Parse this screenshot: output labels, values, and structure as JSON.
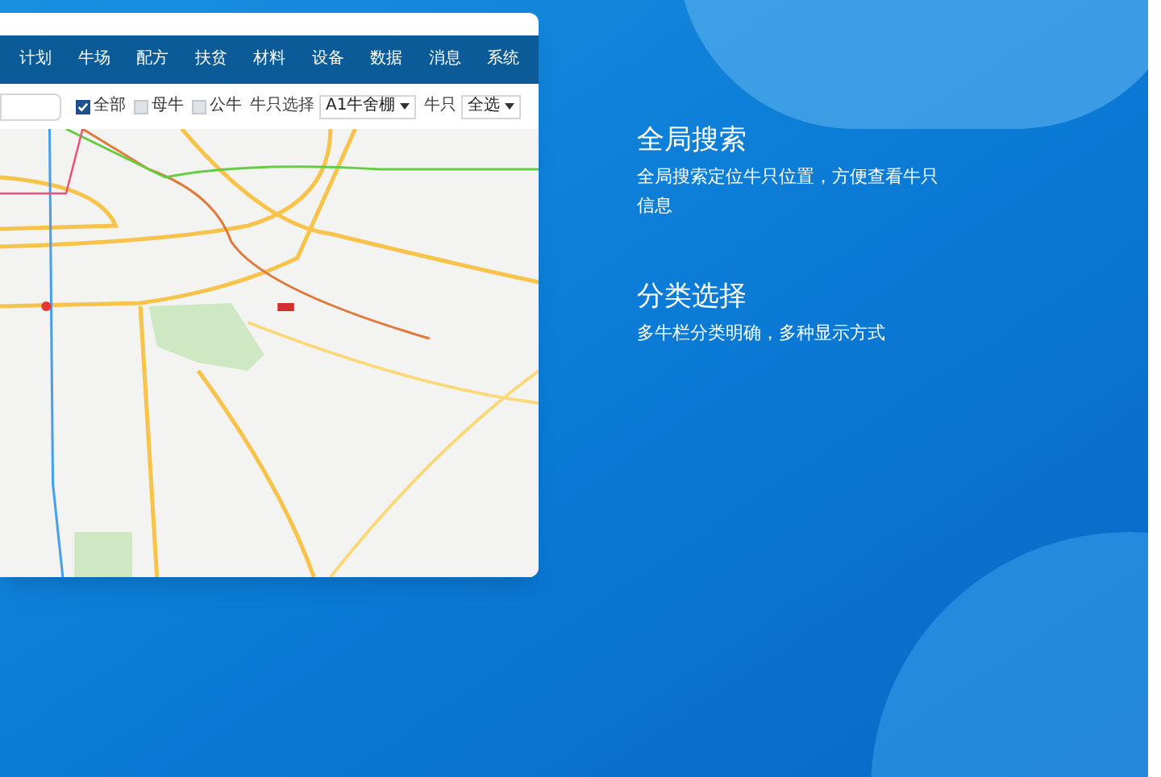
{
  "nav": {
    "items": [
      {
        "label": "计划",
        "selected": false
      },
      {
        "label": "牛场",
        "selected": false
      },
      {
        "label": "配方",
        "selected": false
      },
      {
        "label": "扶贫",
        "selected": false
      },
      {
        "label": "材料",
        "selected": false
      },
      {
        "label": "设备",
        "selected": false
      },
      {
        "label": "数据",
        "selected": false
      },
      {
        "label": "消息",
        "selected": false
      },
      {
        "label": "系统",
        "selected": false
      }
    ]
  },
  "filters": {
    "checkboxes": [
      {
        "label": "全部",
        "checked": true
      },
      {
        "label": "母牛",
        "checked": false
      },
      {
        "label": "公牛",
        "checked": false
      }
    ],
    "selects": [
      {
        "label": "牛只选择",
        "value": "A1牛舍棚"
      },
      {
        "label": "牛只",
        "value": "全选"
      }
    ]
  },
  "features": [
    {
      "title": "全局搜索",
      "description": "全局搜索定位牛只位置，方便查看牛只信息"
    },
    {
      "title": "分类选择",
      "description": "多牛栏分类明确，多种显示方式"
    }
  ]
}
